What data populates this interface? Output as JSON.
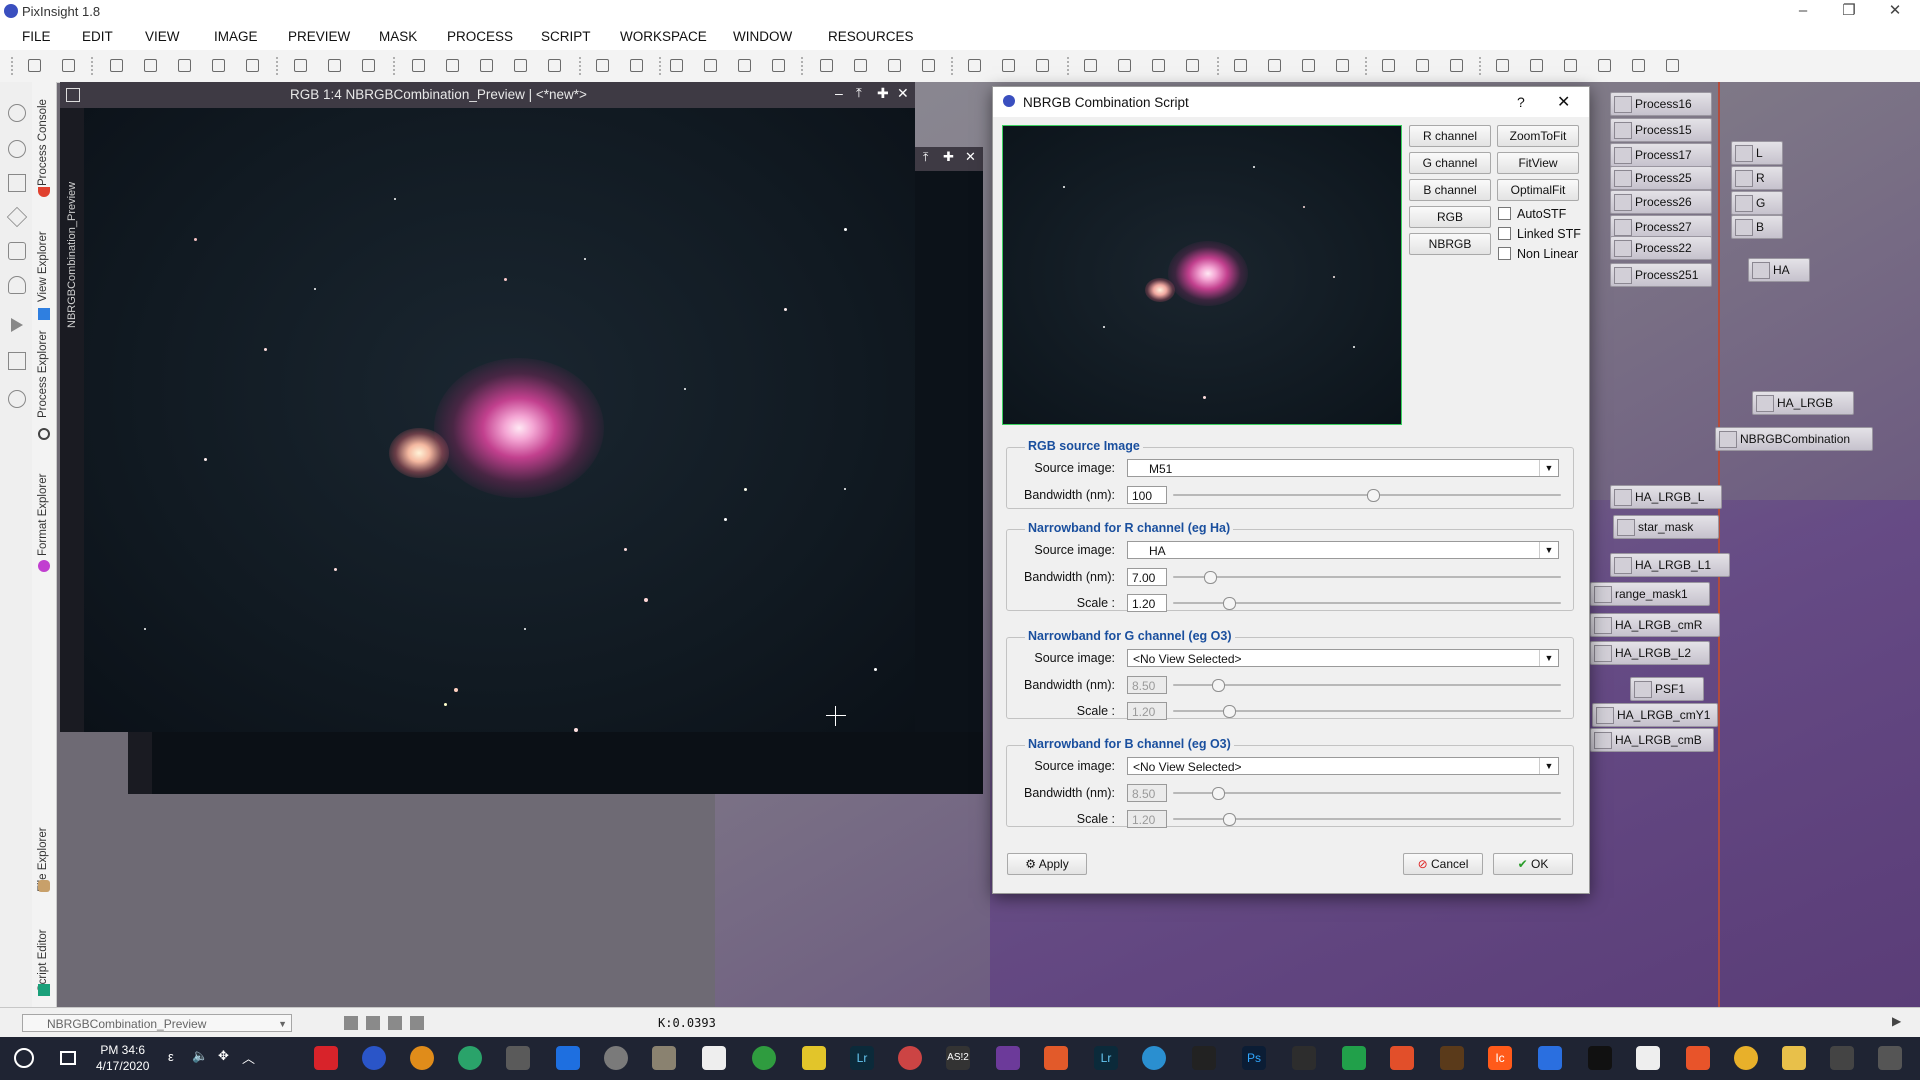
{
  "app": {
    "title": "PixInsight 1.8"
  },
  "menu": [
    "FILE",
    "EDIT",
    "VIEW",
    "IMAGE",
    "PREVIEW",
    "MASK",
    "PROCESS",
    "SCRIPT",
    "WORKSPACE",
    "WINDOW",
    "RESOURCES"
  ],
  "left_tabs": [
    "Process Console",
    "View Explorer",
    "Process Explorer",
    "Format Explorer",
    "File Explorer",
    "Script Editor"
  ],
  "image_window": {
    "title": "RGB 1:4 NBRGBCombination_Preview | <*new*>",
    "side_label": "NBRGBCombination_Preview"
  },
  "dialog": {
    "title": "NBRGB Combination Script",
    "help": "?",
    "buttons_left": [
      "R channel",
      "G channel",
      "B channel",
      "RGB",
      "NBRGB"
    ],
    "buttons_right": [
      "ZoomToFit",
      "FitView",
      "OptimalFit"
    ],
    "checkboxes": [
      "AutoSTF",
      "Linked STF",
      "Non Linear"
    ],
    "rgb_source": {
      "title": "RGB source Image",
      "source_label": "Source image:",
      "source_value": "M51",
      "bandwidth_label": "Bandwidth (nm):",
      "bandwidth": "100",
      "bandwidth_level": 0.5
    },
    "r_channel": {
      "title": "Narrowband for R channel (eg Ha)",
      "source_label": "Source image:",
      "source_value": "HA",
      "bandwidth_label": "Bandwidth (nm):",
      "bandwidth": "7.00",
      "bandwidth_level": 0.08,
      "scale_label": "Scale :",
      "scale": "1.20",
      "scale_level": 0.13
    },
    "g_channel": {
      "title": "Narrowband for G channel (eg O3)",
      "source_label": "Source image:",
      "source_value": "<No View Selected>",
      "bandwidth_label": "Bandwidth (nm):",
      "bandwidth": "8.50",
      "bandwidth_level": 0.1,
      "scale_label": "Scale :",
      "scale": "1.20",
      "scale_level": 0.13
    },
    "b_channel": {
      "title": "Narrowband for B channel (eg O3)",
      "source_label": "Source image:",
      "source_value": "<No View Selected>",
      "bandwidth_label": "Bandwidth (nm):",
      "bandwidth": "8.50",
      "bandwidth_level": 0.1,
      "scale_label": "Scale :",
      "scale": "1.20",
      "scale_level": 0.13
    },
    "apply": "Apply",
    "cancel": "Cancel",
    "ok": "OK"
  },
  "process_icons": [
    "Process16",
    "Process15",
    "Process17",
    "Process25",
    "Process26",
    "Process27",
    "Process22",
    "Process251"
  ],
  "channel_icons": [
    "L",
    "R",
    "G",
    "B",
    "HA"
  ],
  "workspace_icons": [
    "HA_LRGB",
    "NBRGBCombination",
    "HA_LRGB_L",
    "star_mask",
    "HA_LRGB_L1",
    "range_mask1",
    "HA_LRGB_cmR",
    "HA_LRGB_L2",
    "PSF1",
    "HA_LRGB_cmY1",
    "HA_LRGB_cmB"
  ],
  "status": {
    "view": "NBRGBCombination_Preview",
    "readout": "K:0.0393"
  },
  "taskbar": {
    "time": "PM 34:6",
    "date": "4/17/2020",
    "apps": [
      "Lr",
      "Lr",
      "Ps",
      "Ic",
      "AS!2"
    ]
  },
  "colors": {
    "accent": "#3a4fbf",
    "group_title": "#1a4f9e",
    "preview_border": "#3bd160",
    "workspace_line": "#b24c3d"
  }
}
